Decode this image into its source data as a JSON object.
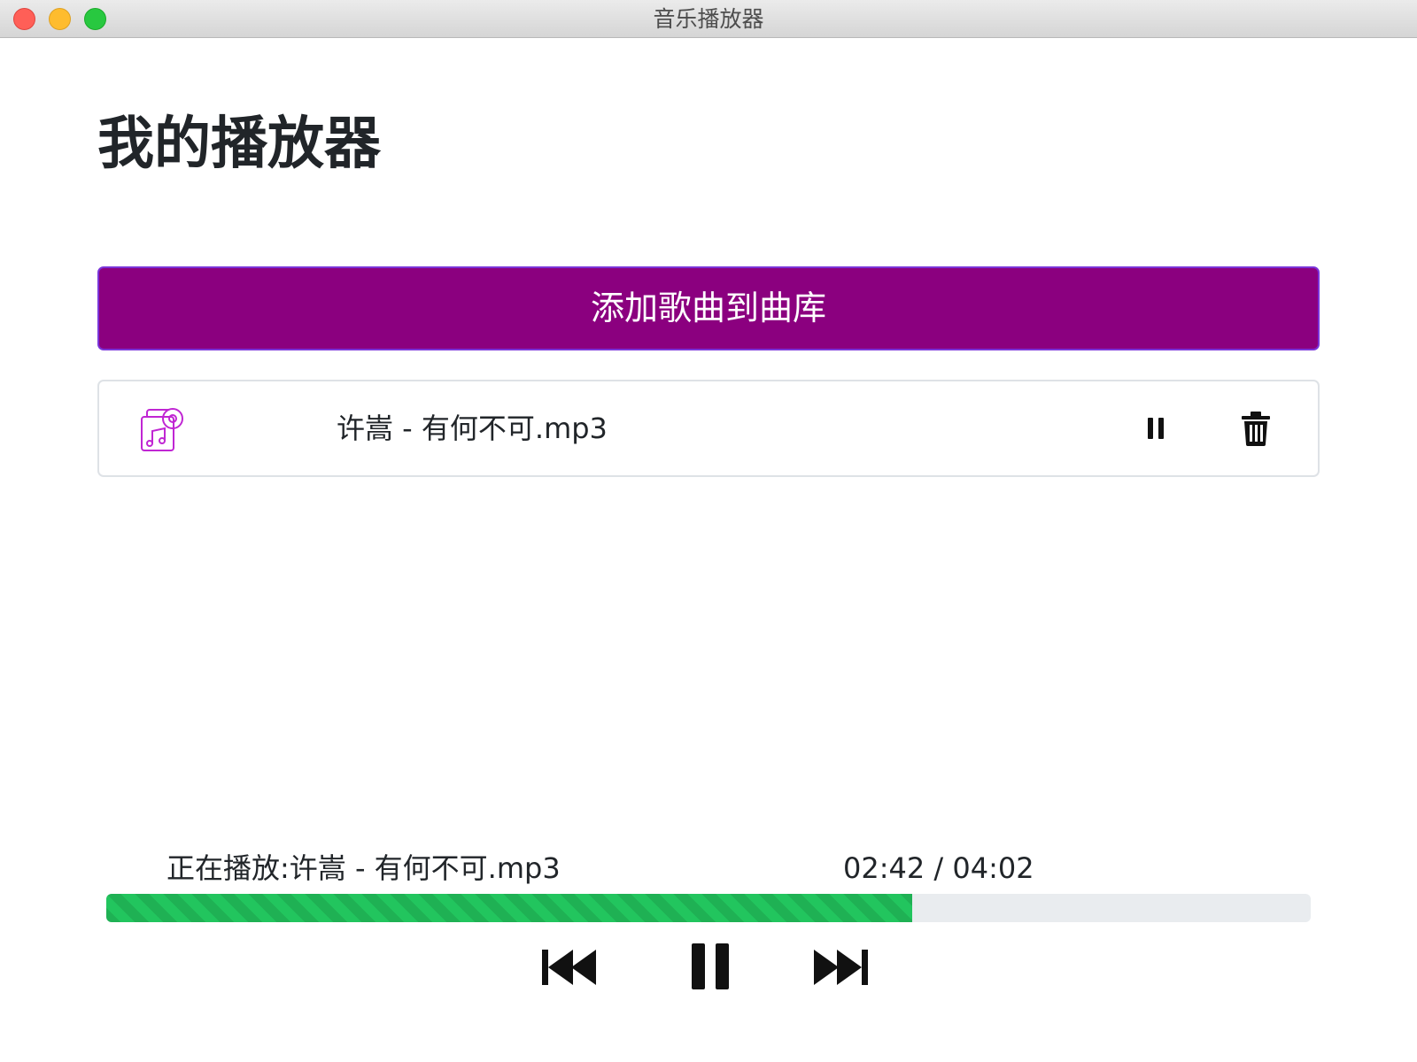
{
  "window": {
    "title": "音乐播放器"
  },
  "page": {
    "title": "我的播放器"
  },
  "library": {
    "add_button_label": "添加歌曲到曲库",
    "songs": [
      {
        "name": "许嵩 - 有何不可.mp3",
        "icon": "music-album-icon",
        "state_icon": "pause-icon",
        "delete_icon": "trash-icon"
      }
    ]
  },
  "player": {
    "now_playing": "正在播放:许嵩 - 有何不可.mp3",
    "time": "02:42 / 04:02",
    "progress": 0.669,
    "controls": {
      "previous_icon": "skip-previous-icon",
      "play_pause_icon": "pause-icon",
      "next_icon": "skip-next-icon"
    }
  },
  "colors": {
    "accent": "#8b007f",
    "accent_border": "#7a34d9",
    "icon_purple": "#c026d3",
    "progress_fill": "#22c55e",
    "progress_track": "#e9ecef"
  }
}
